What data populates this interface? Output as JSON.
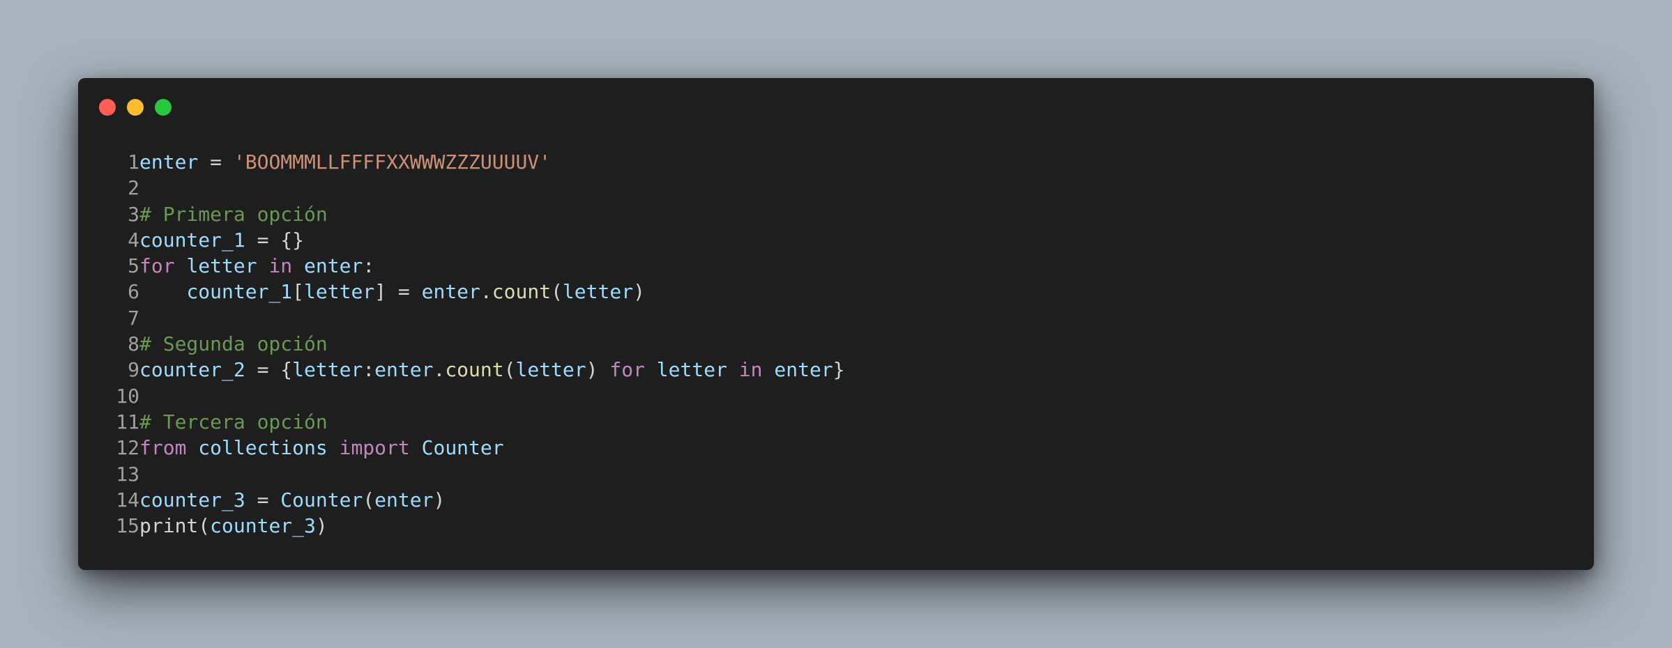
{
  "window": {
    "controls": {
      "close": "#ff5f57",
      "minimize": "#febc2e",
      "maximize": "#28c840"
    }
  },
  "code": {
    "lines": [
      {
        "num": "1",
        "tokens": [
          {
            "t": "enter",
            "c": "var"
          },
          {
            "t": " = ",
            "c": "op"
          },
          {
            "t": "'BOOMMMLLFFFFXXWWWZZZUUUUV'",
            "c": "str"
          }
        ]
      },
      {
        "num": "2",
        "tokens": []
      },
      {
        "num": "3",
        "tokens": [
          {
            "t": "# Primera opción",
            "c": "com"
          }
        ]
      },
      {
        "num": "4",
        "tokens": [
          {
            "t": "counter_1",
            "c": "var"
          },
          {
            "t": " = {}",
            "c": "op"
          }
        ]
      },
      {
        "num": "5",
        "tokens": [
          {
            "t": "for",
            "c": "kw"
          },
          {
            "t": " ",
            "c": "op"
          },
          {
            "t": "letter",
            "c": "var"
          },
          {
            "t": " ",
            "c": "op"
          },
          {
            "t": "in",
            "c": "kw"
          },
          {
            "t": " ",
            "c": "op"
          },
          {
            "t": "enter",
            "c": "var"
          },
          {
            "t": ":",
            "c": "op"
          }
        ]
      },
      {
        "num": "6",
        "tokens": [
          {
            "t": "    ",
            "c": "op"
          },
          {
            "t": "counter_1",
            "c": "var"
          },
          {
            "t": "[",
            "c": "op"
          },
          {
            "t": "letter",
            "c": "var"
          },
          {
            "t": "] = ",
            "c": "op"
          },
          {
            "t": "enter",
            "c": "var"
          },
          {
            "t": ".",
            "c": "op"
          },
          {
            "t": "count",
            "c": "fn"
          },
          {
            "t": "(",
            "c": "op"
          },
          {
            "t": "letter",
            "c": "var"
          },
          {
            "t": ")",
            "c": "op"
          }
        ]
      },
      {
        "num": "7",
        "tokens": []
      },
      {
        "num": "8",
        "tokens": [
          {
            "t": "# Segunda opción",
            "c": "com"
          }
        ]
      },
      {
        "num": "9",
        "tokens": [
          {
            "t": "counter_2",
            "c": "var"
          },
          {
            "t": " = {",
            "c": "op"
          },
          {
            "t": "letter",
            "c": "var"
          },
          {
            "t": ":",
            "c": "op"
          },
          {
            "t": "enter",
            "c": "var"
          },
          {
            "t": ".",
            "c": "op"
          },
          {
            "t": "count",
            "c": "fn"
          },
          {
            "t": "(",
            "c": "op"
          },
          {
            "t": "letter",
            "c": "var"
          },
          {
            "t": ") ",
            "c": "op"
          },
          {
            "t": "for",
            "c": "kw"
          },
          {
            "t": " ",
            "c": "op"
          },
          {
            "t": "letter",
            "c": "var"
          },
          {
            "t": " ",
            "c": "op"
          },
          {
            "t": "in",
            "c": "kw"
          },
          {
            "t": " ",
            "c": "op"
          },
          {
            "t": "enter",
            "c": "var"
          },
          {
            "t": "}",
            "c": "op"
          }
        ]
      },
      {
        "num": "10",
        "tokens": []
      },
      {
        "num": "11",
        "tokens": [
          {
            "t": "# Tercera opción",
            "c": "com"
          }
        ]
      },
      {
        "num": "12",
        "tokens": [
          {
            "t": "from",
            "c": "kw"
          },
          {
            "t": " ",
            "c": "op"
          },
          {
            "t": "collections",
            "c": "var"
          },
          {
            "t": " ",
            "c": "op"
          },
          {
            "t": "import",
            "c": "kw"
          },
          {
            "t": " ",
            "c": "op"
          },
          {
            "t": "Counter",
            "c": "cls"
          }
        ]
      },
      {
        "num": "13",
        "tokens": []
      },
      {
        "num": "14",
        "tokens": [
          {
            "t": "counter_3",
            "c": "var"
          },
          {
            "t": " = ",
            "c": "op"
          },
          {
            "t": "Counter",
            "c": "cls"
          },
          {
            "t": "(",
            "c": "op"
          },
          {
            "t": "enter",
            "c": "var"
          },
          {
            "t": ")",
            "c": "op"
          }
        ]
      },
      {
        "num": "15",
        "tokens": [
          {
            "t": "print",
            "c": "plain"
          },
          {
            "t": "(",
            "c": "op"
          },
          {
            "t": "counter_3",
            "c": "var"
          },
          {
            "t": ")",
            "c": "op"
          }
        ]
      }
    ]
  }
}
